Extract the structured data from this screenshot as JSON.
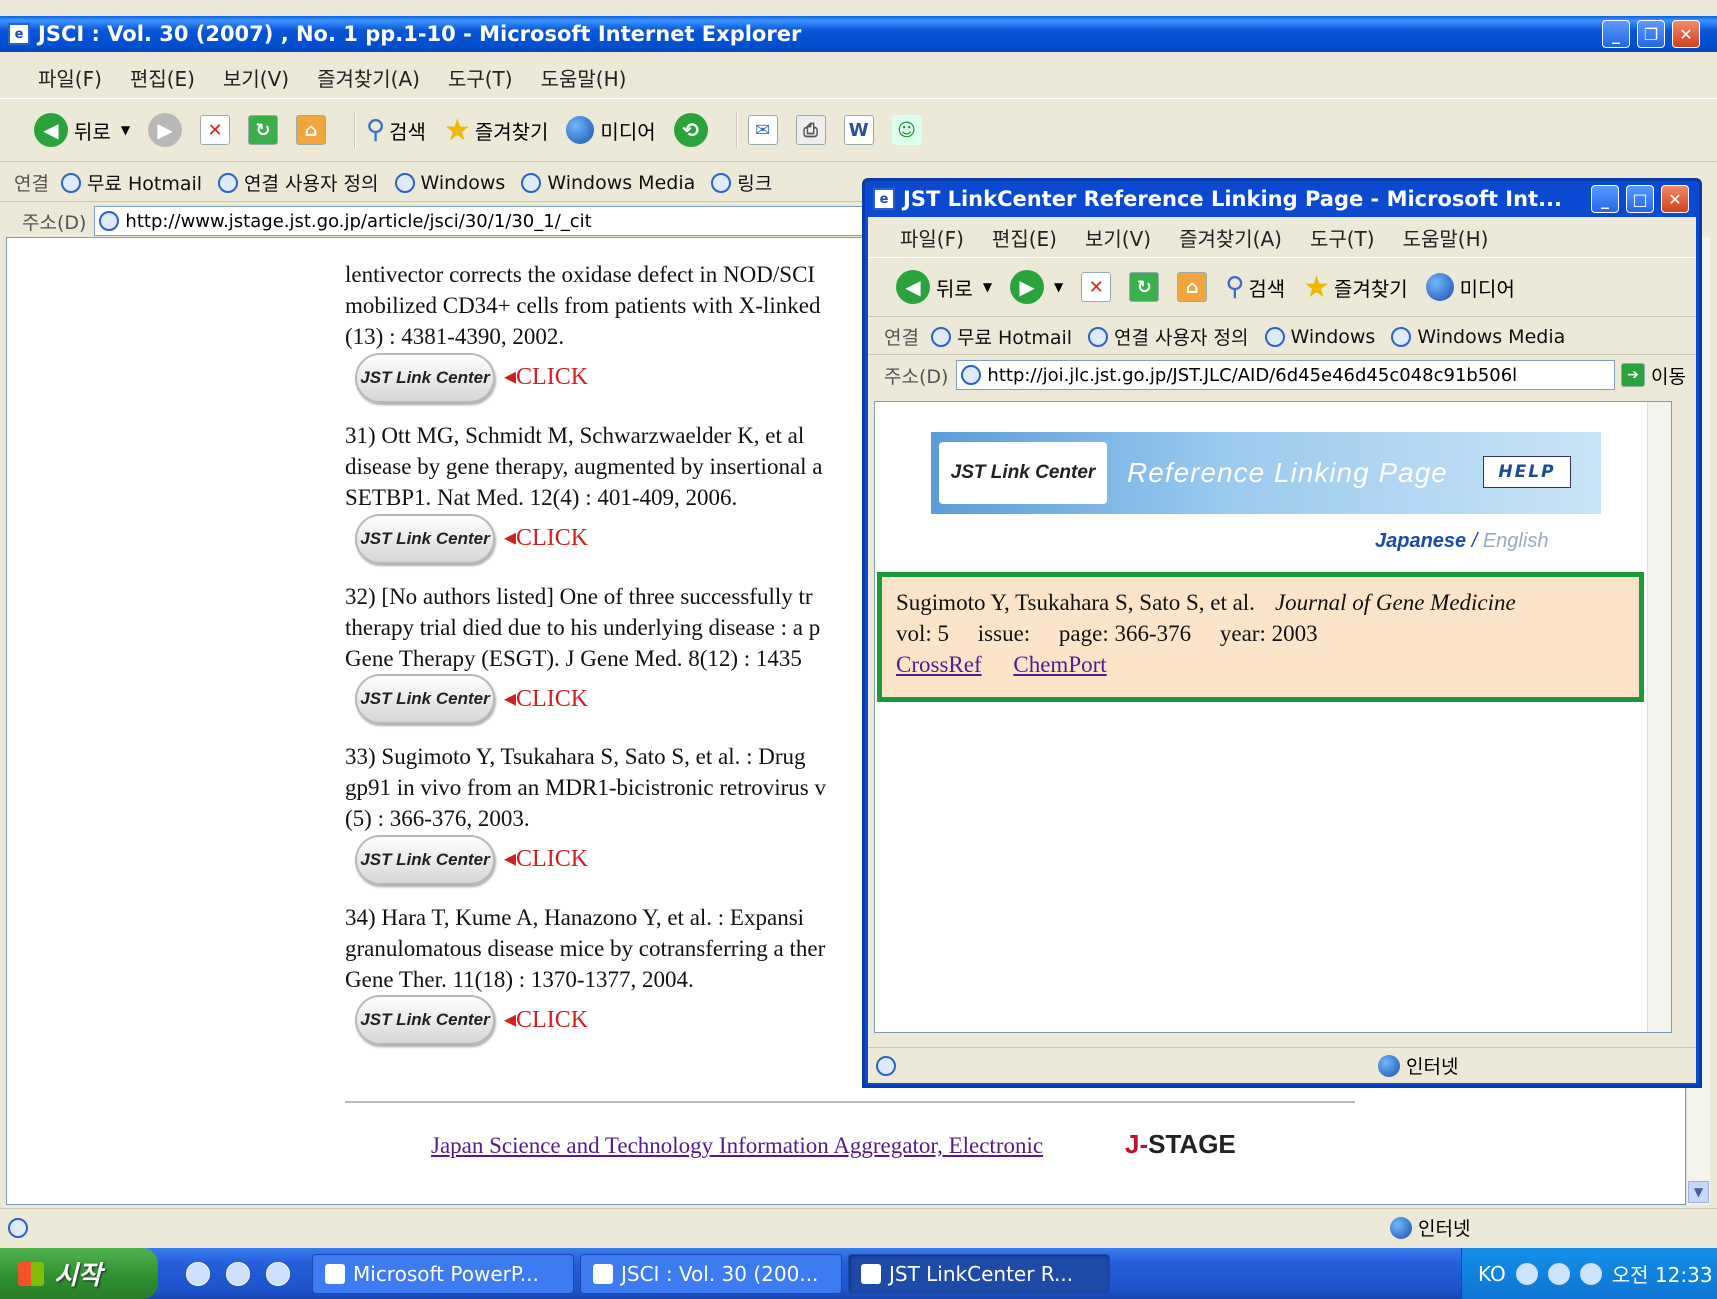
{
  "main_window": {
    "title": "JSCI : Vol. 30 (2007) , No. 1 pp.1-10 - Microsoft Internet Explorer",
    "menu": [
      "파일(F)",
      "편집(E)",
      "보기(V)",
      "즐겨찾기(A)",
      "도구(T)",
      "도움말(H)"
    ],
    "toolbar": {
      "back": "뒤로",
      "search": "검색",
      "favorites": "즐겨찾기",
      "media": "미디어"
    },
    "links": {
      "label": "연결",
      "items": [
        "무료 Hotmail",
        "연결 사용자 정의",
        "Windows",
        "Windows Media",
        "링크"
      ]
    },
    "address": {
      "label": "주소(D)",
      "url": "http://www.jstage.jst.go.jp/article/jsci/30/1/30_1/_cit"
    },
    "status": "인터넷"
  },
  "references": [
    {
      "lines": [
        "lentivector corrects the oxidase defect in NOD/SCI",
        "mobilized CD34+ cells from patients with X-linked",
        "(13) : 4381-4390, 2002."
      ]
    },
    {
      "lines": [
        "31) Ott MG, Schmidt M, Schwarzwaelder K, et al",
        "disease by gene therapy, augmented by insertional a",
        "SETBP1. Nat Med. 12(4) : 401-409, 2006."
      ]
    },
    {
      "lines": [
        "32) [No authors listed] One of three successfully tr",
        "therapy trial died due to his underlying disease : a p",
        "Gene Therapy (ESGT). J Gene Med. 8(12) : 1435"
      ]
    },
    {
      "lines": [
        "33) Sugimoto Y, Tsukahara S, Sato S, et al. : Drug",
        "gp91 in vivo from an MDR1-bicistronic retrovirus v",
        "(5) : 366-376, 2003."
      ]
    },
    {
      "lines": [
        "34) Hara T, Kume A, Hanazono Y, et al. : Expansi",
        "granulomatous disease mice by cotransferring a ther",
        "Gene Ther. 11(18) : 1370-1377, 2004."
      ]
    }
  ],
  "jst_button_label": "JST Link Center",
  "click_label": "CLICK",
  "footer": {
    "link": "Japan Science and Technology Information Aggregator, Electronic",
    "logo_prefix": "J-",
    "logo_rest": "STAGE"
  },
  "popup": {
    "title": "JST LinkCenter Reference Linking Page - Microsoft Int...",
    "menu": [
      "파일(F)",
      "편집(E)",
      "보기(V)",
      "즐겨찾기(A)",
      "도구(T)",
      "도움말(H)"
    ],
    "toolbar": {
      "back": "뒤로",
      "search": "검색",
      "favorites": "즐겨찾기",
      "media": "미디어"
    },
    "links": {
      "label": "연결",
      "items": [
        "무료 Hotmail",
        "연결 사용자 정의",
        "Windows",
        "Windows Media"
      ]
    },
    "address": {
      "label": "주소(D)",
      "url": "http://joi.jlc.jst.go.jp/JST.JLC/AID/6d45e46d45c048c91b506l",
      "go": "이동"
    },
    "banner": {
      "logo": "JST Link Center",
      "title": "Reference Linking Page",
      "help": "HELP"
    },
    "lang": {
      "japanese": "Japanese",
      "sep": " / ",
      "english": "English"
    },
    "reference": {
      "authors": "Sugimoto Y, Tsukahara S, Sato S, et al.",
      "journal": "Journal of Gene Medicine",
      "vol": "vol: 5",
      "issue": "issue:",
      "page": "page: 366-376",
      "year": "year: 2003",
      "links": [
        "CrossRef",
        "ChemPort"
      ]
    },
    "status": "인터넷"
  },
  "taskbar": {
    "start": "시작",
    "tasks": [
      "Microsoft PowerP...",
      "JSCI : Vol. 30 (200...",
      "JST LinkCenter R..."
    ],
    "tray_lang": "KO",
    "clock": "오전 12:33"
  },
  "colors": {
    "xp_blue": "#0a55d8",
    "click_red": "#d02020",
    "visited_link": "#551a8b",
    "refbox_bg": "#fce4c8",
    "refbox_border": "#1a9a3a"
  }
}
